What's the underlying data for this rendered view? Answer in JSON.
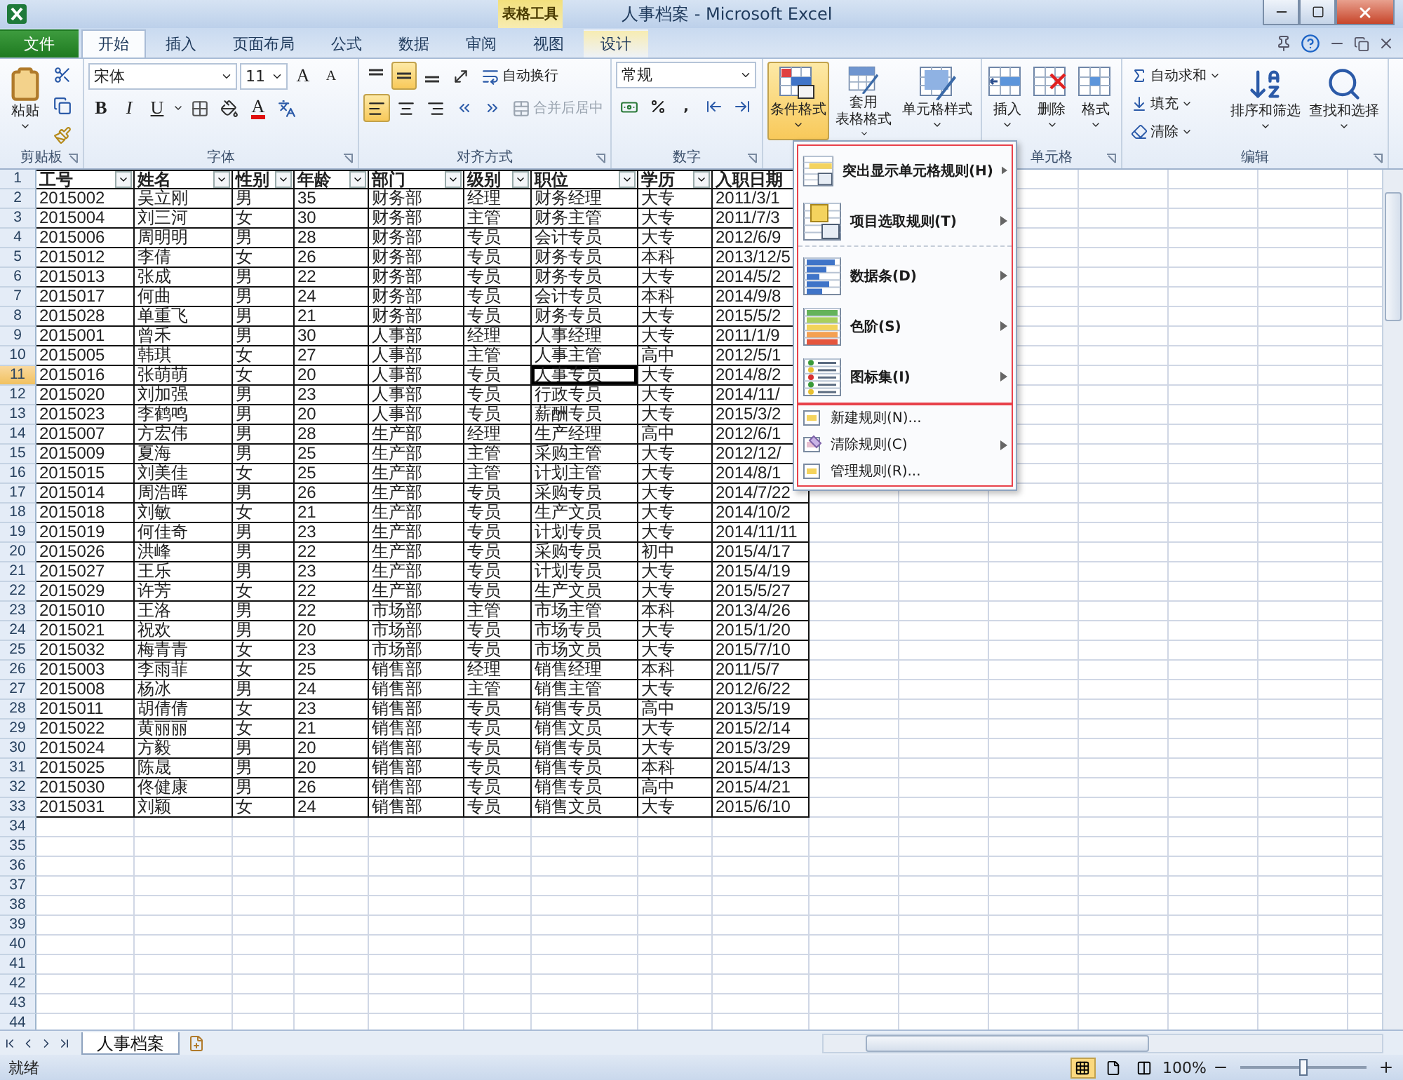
{
  "window": {
    "title": "人事档案 - Microsoft Excel",
    "contextual_group": "表格工具"
  },
  "tabs": [
    {
      "label": "文件",
      "kind": "file",
      "selected": false
    },
    {
      "label": "开始",
      "kind": "tab",
      "selected": true
    },
    {
      "label": "插入",
      "kind": "tab",
      "selected": false
    },
    {
      "label": "页面布局",
      "kind": "tab",
      "selected": false
    },
    {
      "label": "公式",
      "kind": "tab",
      "selected": false
    },
    {
      "label": "数据",
      "kind": "tab",
      "selected": false
    },
    {
      "label": "审阅",
      "kind": "tab",
      "selected": false
    },
    {
      "label": "视图",
      "kind": "tab",
      "selected": false
    },
    {
      "label": "设计",
      "kind": "contextual",
      "selected": false
    }
  ],
  "ribbon": {
    "clipboard": {
      "label": "剪贴板",
      "paste": "粘贴"
    },
    "font": {
      "label": "字体",
      "font_name": "宋体",
      "font_size": "11",
      "grow": "A",
      "shrink": "A",
      "styles": [
        "B",
        "I",
        "U"
      ],
      "color_letter": "A"
    },
    "alignment": {
      "label": "对齐方式",
      "vertical": [
        {
          "selected": false
        },
        {
          "selected": true
        },
        {
          "selected": false
        }
      ],
      "horizontal": [
        {
          "selected": true
        },
        {
          "selected": false
        },
        {
          "selected": false
        }
      ],
      "wrap": {
        "label": "自动换行",
        "disabled": false
      },
      "merge": {
        "label": "合并后居中",
        "disabled": true
      }
    },
    "number": {
      "label": "数字",
      "format": "常规",
      "comma": ","
    },
    "styles": [
      {
        "lines": [
          "条件格式"
        ],
        "selected": true
      },
      {
        "lines": [
          "套用",
          "表格格式"
        ],
        "selected": false
      },
      {
        "lines": [
          "单元格样式"
        ],
        "selected": false
      }
    ],
    "cells": {
      "label": "单元格",
      "buttons": [
        "插入",
        "删除",
        "格式"
      ]
    },
    "editing": {
      "label": "编辑",
      "small": [
        "自动求和",
        "填充",
        "清除"
      ],
      "big": [
        "排序和筛选",
        "查找和选择"
      ]
    }
  },
  "sheet": {
    "columns": [
      {
        "label": "工号",
        "filter_button": true
      },
      {
        "label": "姓名",
        "filter_button": true
      },
      {
        "label": "性别",
        "filter_button": true
      },
      {
        "label": "年龄",
        "filter_button": true
      },
      {
        "label": "部门",
        "filter_button": true
      },
      {
        "label": "级别",
        "filter_button": true
      },
      {
        "label": "职位",
        "filter_button": true
      },
      {
        "label": "学历",
        "filter_button": true
      },
      {
        "label": "入职日期"
      }
    ],
    "rows": [
      {
        "number": "1",
        "kind": "header",
        "selected": false
      },
      {
        "number": "2",
        "kind": "data",
        "selected": false,
        "cells": [
          "2015002",
          "吴立刚",
          "男",
          "35",
          "财务部",
          "经理",
          "财务经理",
          "大专",
          "2011/3/1"
        ]
      },
      {
        "number": "3",
        "kind": "data",
        "selected": false,
        "cells": [
          "2015004",
          "刘三河",
          "女",
          "30",
          "财务部",
          "主管",
          "财务主管",
          "大专",
          "2011/7/3"
        ]
      },
      {
        "number": "4",
        "kind": "data",
        "selected": false,
        "cells": [
          "2015006",
          "周明明",
          "男",
          "28",
          "财务部",
          "专员",
          "会计专员",
          "大专",
          "2012/6/9"
        ]
      },
      {
        "number": "5",
        "kind": "data",
        "selected": false,
        "cells": [
          "2015012",
          "李倩",
          "女",
          "26",
          "财务部",
          "专员",
          "财务专员",
          "本科",
          "2013/12/5"
        ]
      },
      {
        "number": "6",
        "kind": "data",
        "selected": false,
        "cells": [
          "2015013",
          "张成",
          "男",
          "22",
          "财务部",
          "专员",
          "财务专员",
          "大专",
          "2014/5/2"
        ]
      },
      {
        "number": "7",
        "kind": "data",
        "selected": false,
        "cells": [
          "2015017",
          "何曲",
          "男",
          "24",
          "财务部",
          "专员",
          "会计专员",
          "本科",
          "2014/9/8"
        ]
      },
      {
        "number": "8",
        "kind": "data",
        "selected": false,
        "cells": [
          "2015028",
          "单重飞",
          "男",
          "21",
          "财务部",
          "专员",
          "财务专员",
          "大专",
          "2015/5/2"
        ]
      },
      {
        "number": "9",
        "kind": "data",
        "selected": false,
        "cells": [
          "2015001",
          "曾禾",
          "男",
          "30",
          "人事部",
          "经理",
          "人事经理",
          "大专",
          "2011/1/9"
        ]
      },
      {
        "number": "10",
        "kind": "data",
        "selected": false,
        "cells": [
          "2015005",
          "韩琪",
          "女",
          "27",
          "人事部",
          "主管",
          "人事主管",
          "高中",
          "2012/5/1"
        ]
      },
      {
        "number": "11",
        "kind": "data",
        "selected": true,
        "cells": [
          {
            "text": "2015016",
            "selected": false
          },
          {
            "text": "张萌萌",
            "selected": false
          },
          {
            "text": "女",
            "selected": false
          },
          {
            "text": "20",
            "selected": false
          },
          {
            "text": "人事部",
            "selected": false
          },
          {
            "text": "专员",
            "selected": false
          },
          {
            "text": "人事专员",
            "selected": true
          },
          {
            "text": "大专",
            "selected": false
          },
          {
            "text": "2014/8/2",
            "selected": false
          }
        ]
      },
      {
        "number": "12",
        "kind": "data",
        "selected": false,
        "cells": [
          "2015020",
          "刘加强",
          "男",
          "23",
          "人事部",
          "专员",
          "行政专员",
          "大专",
          "2014/11/"
        ]
      },
      {
        "number": "13",
        "kind": "data",
        "selected": false,
        "cells": [
          "2015023",
          "李鹤鸣",
          "男",
          "20",
          "人事部",
          "专员",
          "薪酬专员",
          "大专",
          "2015/3/2"
        ]
      },
      {
        "number": "14",
        "kind": "data",
        "selected": false,
        "cells": [
          "2015007",
          "方宏伟",
          "男",
          "28",
          "生产部",
          "经理",
          "生产经理",
          "高中",
          "2012/6/1"
        ]
      },
      {
        "number": "15",
        "kind": "data",
        "selected": false,
        "cells": [
          "2015009",
          "夏海",
          "男",
          "25",
          "生产部",
          "主管",
          "采购主管",
          "大专",
          "2012/12/"
        ]
      },
      {
        "number": "16",
        "kind": "data",
        "selected": false,
        "cells": [
          "2015015",
          "刘美佳",
          "女",
          "25",
          "生产部",
          "主管",
          "计划主管",
          "大专",
          "2014/8/1"
        ]
      },
      {
        "number": "17",
        "kind": "data",
        "selected": false,
        "cells": [
          "2015014",
          "周浩晖",
          "男",
          "26",
          "生产部",
          "专员",
          "采购专员",
          "大专",
          "2014/7/22"
        ]
      },
      {
        "number": "18",
        "kind": "data",
        "selected": false,
        "cells": [
          "2015018",
          "刘敏",
          "女",
          "21",
          "生产部",
          "专员",
          "生产文员",
          "大专",
          "2014/10/2"
        ]
      },
      {
        "number": "19",
        "kind": "data",
        "selected": false,
        "cells": [
          "2015019",
          "何佳奇",
          "男",
          "23",
          "生产部",
          "专员",
          "计划专员",
          "大专",
          "2014/11/11"
        ]
      },
      {
        "number": "20",
        "kind": "data",
        "selected": false,
        "cells": [
          "2015026",
          "洪峰",
          "男",
          "22",
          "生产部",
          "专员",
          "采购专员",
          "初中",
          "2015/4/17"
        ]
      },
      {
        "number": "21",
        "kind": "data",
        "selected": false,
        "cells": [
          "2015027",
          "王乐",
          "男",
          "23",
          "生产部",
          "专员",
          "计划专员",
          "大专",
          "2015/4/19"
        ]
      },
      {
        "number": "22",
        "kind": "data",
        "selected": false,
        "cells": [
          "2015029",
          "许芳",
          "女",
          "22",
          "生产部",
          "专员",
          "生产文员",
          "大专",
          "2015/5/27"
        ]
      },
      {
        "number": "23",
        "kind": "data",
        "selected": false,
        "cells": [
          "2015010",
          "王洛",
          "男",
          "22",
          "市场部",
          "主管",
          "市场主管",
          "本科",
          "2013/4/26"
        ]
      },
      {
        "number": "24",
        "kind": "data",
        "selected": false,
        "cells": [
          "2015021",
          "祝欢",
          "男",
          "20",
          "市场部",
          "专员",
          "市场专员",
          "大专",
          "2015/1/20"
        ]
      },
      {
        "number": "25",
        "kind": "data",
        "selected": false,
        "cells": [
          "2015032",
          "梅青青",
          "女",
          "23",
          "市场部",
          "专员",
          "市场文员",
          "大专",
          "2015/7/10"
        ]
      },
      {
        "number": "26",
        "kind": "data",
        "selected": false,
        "cells": [
          "2015003",
          "李雨菲",
          "女",
          "25",
          "销售部",
          "经理",
          "销售经理",
          "本科",
          "2011/5/7"
        ]
      },
      {
        "number": "27",
        "kind": "data",
        "selected": false,
        "cells": [
          "2015008",
          "杨冰",
          "男",
          "24",
          "销售部",
          "主管",
          "销售主管",
          "大专",
          "2012/6/22"
        ]
      },
      {
        "number": "28",
        "kind": "data",
        "selected": false,
        "cells": [
          "2015011",
          "胡倩倩",
          "女",
          "23",
          "销售部",
          "专员",
          "销售专员",
          "高中",
          "2013/5/19"
        ]
      },
      {
        "number": "29",
        "kind": "data",
        "selected": false,
        "cells": [
          "2015022",
          "黄丽丽",
          "女",
          "21",
          "销售部",
          "专员",
          "销售文员",
          "大专",
          "2015/2/14"
        ]
      },
      {
        "number": "30",
        "kind": "data",
        "selected": false,
        "cells": [
          "2015024",
          "方毅",
          "男",
          "20",
          "销售部",
          "专员",
          "销售专员",
          "大专",
          "2015/3/29"
        ]
      },
      {
        "number": "31",
        "kind": "data",
        "selected": false,
        "cells": [
          "2015025",
          "陈晟",
          "男",
          "20",
          "销售部",
          "专员",
          "销售专员",
          "本科",
          "2015/4/13"
        ]
      },
      {
        "number": "32",
        "kind": "data",
        "selected": false,
        "cells": [
          "2015030",
          "佟健康",
          "男",
          "26",
          "销售部",
          "专员",
          "销售专员",
          "高中",
          "2015/4/21"
        ]
      },
      {
        "number": "33",
        "kind": "data",
        "selected": false,
        "cells": [
          "2015031",
          "刘颖",
          "女",
          "24",
          "销售部",
          "专员",
          "销售文员",
          "大专",
          "2015/6/10"
        ]
      },
      {
        "number": "34",
        "kind": "empty",
        "selected": false
      },
      {
        "number": "35",
        "kind": "empty",
        "selected": false
      },
      {
        "number": "36",
        "kind": "empty",
        "selected": false
      },
      {
        "number": "37",
        "kind": "empty",
        "selected": false
      },
      {
        "number": "38",
        "kind": "empty",
        "selected": false
      },
      {
        "number": "39",
        "kind": "empty",
        "selected": false
      },
      {
        "number": "40",
        "kind": "empty",
        "selected": false
      },
      {
        "number": "41",
        "kind": "empty",
        "selected": false
      },
      {
        "number": "42",
        "kind": "empty",
        "selected": false
      },
      {
        "number": "43",
        "kind": "empty",
        "selected": false
      },
      {
        "number": "44",
        "kind": "empty",
        "selected": false
      }
    ]
  },
  "menu": {
    "sections": [
      {
        "items": [
          {
            "label": "突出显示单元格规则(H)",
            "kind": "large",
            "submenu": true,
            "divider_after": false
          },
          {
            "label": "项目选取规则(T)",
            "kind": "large",
            "submenu": true,
            "divider_after": true
          },
          {
            "label": "数据条(D)",
            "kind": "large",
            "submenu": true,
            "divider_after": false
          },
          {
            "label": "色阶(S)",
            "kind": "large",
            "submenu": true,
            "divider_after": false
          },
          {
            "label": "图标集(I)",
            "kind": "large",
            "submenu": true,
            "divider_after": false
          }
        ]
      },
      {
        "items": [
          {
            "label": "新建规则(N)...",
            "kind": "small",
            "submenu": false,
            "divider_after": false
          },
          {
            "label": "清除规则(C)",
            "kind": "small",
            "submenu": true,
            "divider_after": false
          },
          {
            "label": "管理规则(R)...",
            "kind": "small",
            "submenu": false,
            "divider_after": false
          }
        ]
      }
    ]
  },
  "sheet_tabs": [
    {
      "label": "人事档案",
      "selected": true
    }
  ],
  "status_bar": {
    "text": "就绪",
    "views": [
      {
        "selected": true
      },
      {
        "selected": false
      },
      {
        "selected": false
      }
    ],
    "zoom": "100%",
    "zoom_slider": {
      "level": 0.5
    }
  }
}
